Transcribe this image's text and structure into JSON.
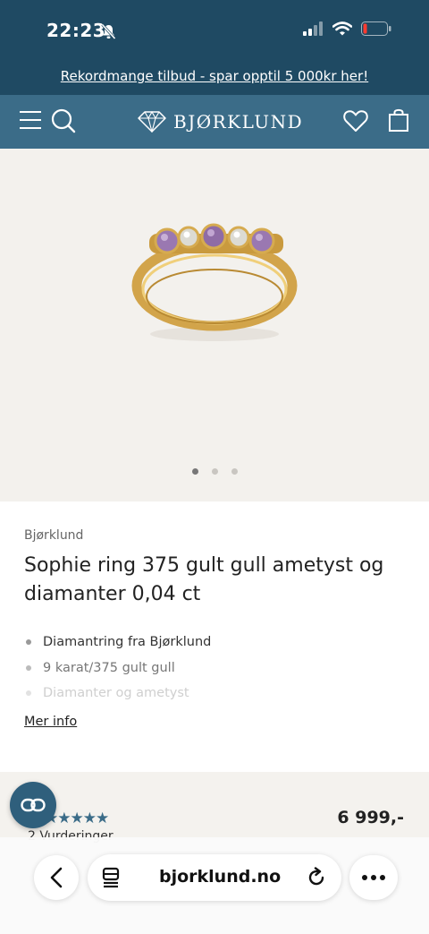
{
  "status": {
    "time": "22:23"
  },
  "promo": {
    "text": "Rekordmange tilbud - spar opptil 5 000kr her!"
  },
  "nav": {
    "logo_text": "BJØRKLUND"
  },
  "product": {
    "brand": "Bjørklund",
    "title": "Sophie ring 375 gult gull ametyst og diamanter 0,04 ct",
    "bullets": [
      "Diamantring fra Bjørklund",
      "9 karat/375 gult gull",
      "Diamanter og ametyst"
    ],
    "more_info": "Mer info",
    "image_dots": {
      "count": 3,
      "active": 1
    }
  },
  "reviews": {
    "stars": "★★★★★",
    "count_text": "2 Vurderinger",
    "price": "6 999,-"
  },
  "browser": {
    "url": "bjorklund.no"
  },
  "colors": {
    "header_dark": "#1f4a63",
    "nav_blue": "#3b6c88",
    "hero_bg": "#f3f1ed",
    "accent_star": "#3b6c88"
  }
}
